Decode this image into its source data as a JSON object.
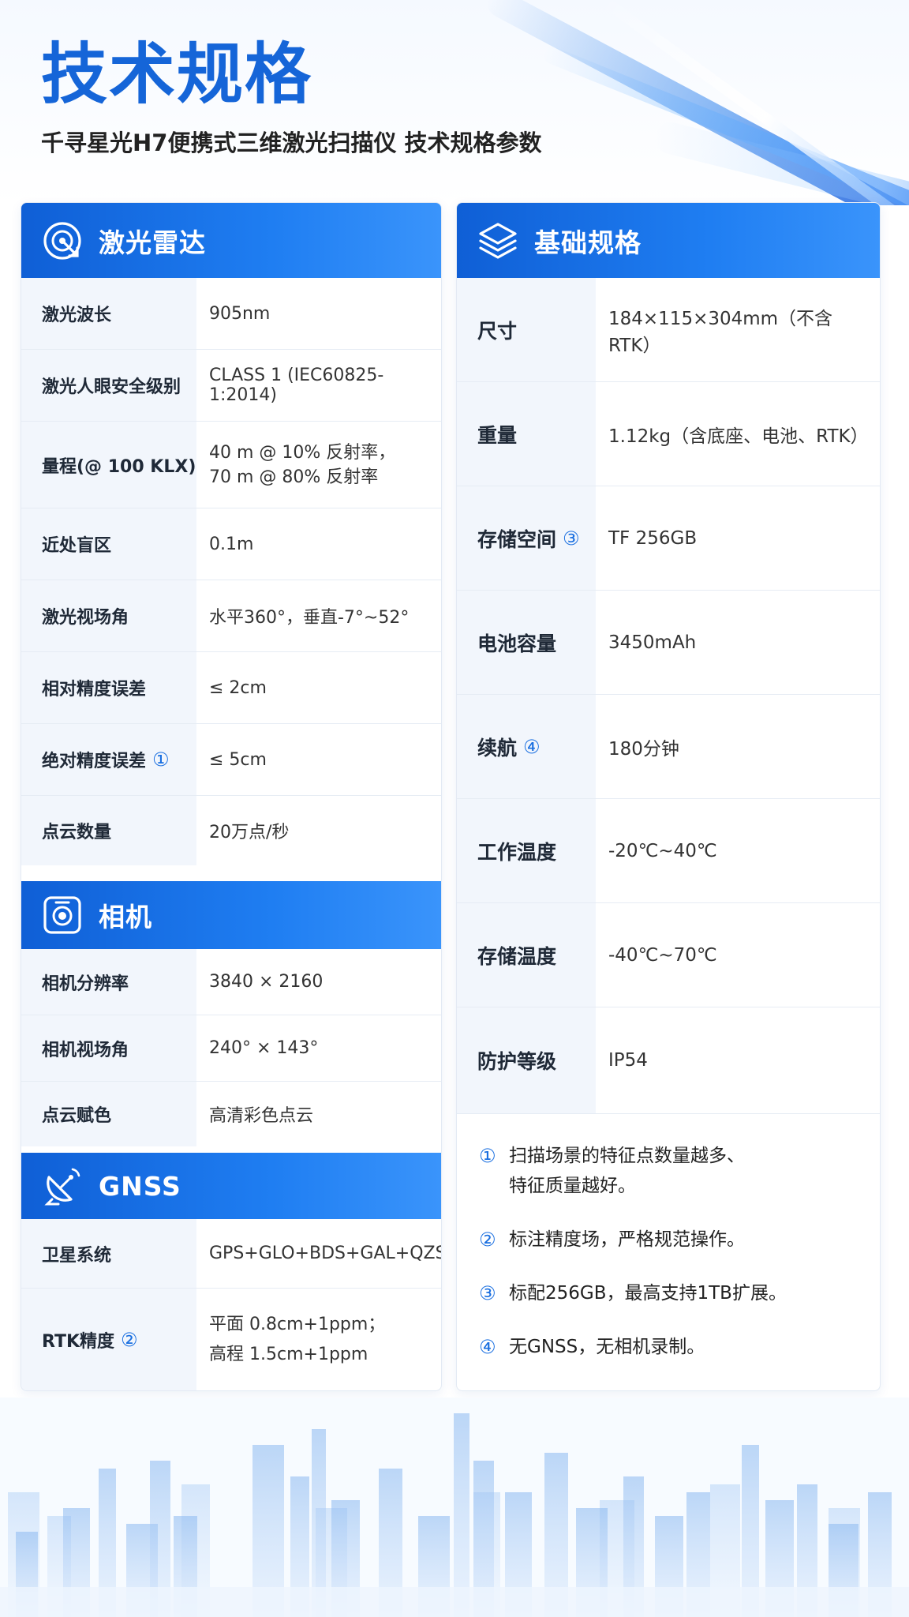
{
  "header": {
    "title": "技术规格",
    "subtitle": "千寻星光H7便携式三维激光扫描仪 技术规格参数"
  },
  "lidar": {
    "title": "激光雷达",
    "icon": "lidar-scan-icon",
    "rows": [
      {
        "key": "激光波长",
        "value": "905nm"
      },
      {
        "key": "激光人眼安全级别",
        "value": "CLASS 1 (IEC60825-1:2014)"
      },
      {
        "key": "量程(@ 100 KLX)",
        "value": "40 m @ 10% 反射率，",
        "value2": "70 m @ 80% 反射率"
      },
      {
        "key": "近处盲区",
        "value": "0.1m"
      },
      {
        "key": "激光视场角",
        "value": "水平360°，垂直-7°~52°"
      },
      {
        "key": "相对精度误差",
        "value": "≤ 2cm"
      },
      {
        "key": "绝对精度误差",
        "mark": "①",
        "value": "≤ 5cm"
      },
      {
        "key": "点云数量",
        "value": "20万点/秒"
      }
    ]
  },
  "camera": {
    "title": "相机",
    "icon": "camera-icon",
    "rows": [
      {
        "key": "相机分辨率",
        "value": "3840 × 2160"
      },
      {
        "key": "相机视场角",
        "value": "240° × 143°"
      },
      {
        "key": "点云赋色",
        "value": "高清彩色点云"
      }
    ]
  },
  "gnss": {
    "title": "GNSS",
    "icon": "satellite-dish-icon",
    "rows": [
      {
        "key": "卫星系统",
        "value": "GPS+GLO+BDS+GAL+QZSS"
      },
      {
        "key": "RTK精度",
        "mark": "②",
        "value": "平面 0.8cm+1ppm；",
        "value2": "高程 1.5cm+1ppm"
      }
    ]
  },
  "basic": {
    "title": "基础规格",
    "icon": "layers-icon",
    "rows": [
      {
        "key": "尺寸",
        "value": "184×115×304mm（不含RTK）"
      },
      {
        "key": "重量",
        "value": "1.12kg（含底座、电池、RTK）"
      },
      {
        "key": "存储空间",
        "mark": "③",
        "value": "TF 256GB"
      },
      {
        "key": "电池容量",
        "value": "3450mAh"
      },
      {
        "key": "续航",
        "mark": "④",
        "value": "180分钟"
      },
      {
        "key": "工作温度",
        "value": "-20℃~40℃"
      },
      {
        "key": "存储温度",
        "value": "-40℃~70℃"
      },
      {
        "key": "防护等级",
        "value": "IP54"
      }
    ]
  },
  "notes": [
    {
      "num": "①",
      "text": "扫描场景的特征点数量越多、",
      "text2": "特征质量越好。"
    },
    {
      "num": "②",
      "text": "标注精度场，严格规范操作。"
    },
    {
      "num": "③",
      "text": "标配256GB，最高支持1TB扩展。"
    },
    {
      "num": "④",
      "text": "无GNSS，无相机录制。"
    }
  ],
  "colors": {
    "accent": "#1565d8",
    "header_bar": "#1a73e8",
    "key_bg": "#f2f6fc"
  }
}
